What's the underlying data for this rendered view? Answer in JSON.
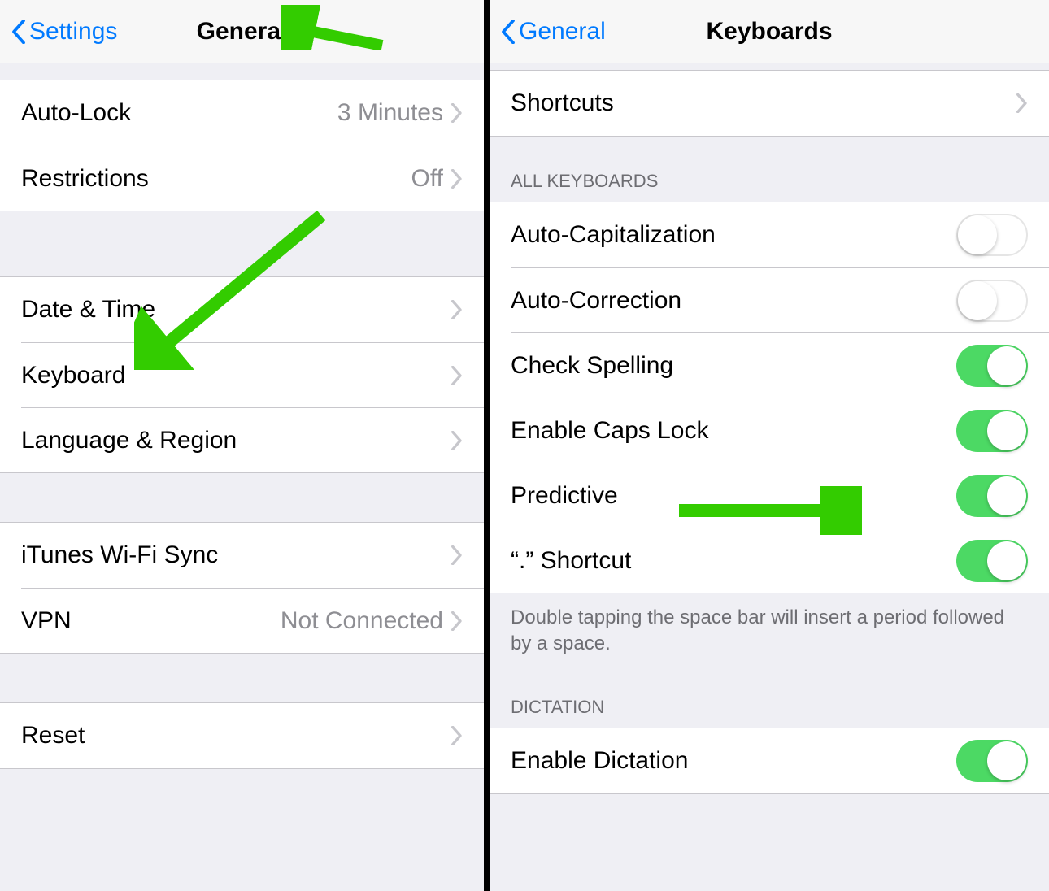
{
  "colors": {
    "accent": "#007aff",
    "toggleOn": "#4cd964",
    "arrow": "#33cc00"
  },
  "left": {
    "back": "Settings",
    "title": "General",
    "groups": [
      {
        "rows": [
          {
            "label": "Auto-Lock",
            "value": "3 Minutes",
            "disclosure": true
          },
          {
            "label": "Restrictions",
            "value": "Off",
            "disclosure": true
          }
        ]
      },
      {
        "rows": [
          {
            "label": "Date & Time",
            "disclosure": true
          },
          {
            "label": "Keyboard",
            "disclosure": true
          },
          {
            "label": "Language & Region",
            "disclosure": true
          }
        ]
      },
      {
        "rows": [
          {
            "label": "iTunes Wi-Fi Sync",
            "disclosure": true
          },
          {
            "label": "VPN",
            "value": "Not Connected",
            "disclosure": true
          }
        ]
      },
      {
        "rows": [
          {
            "label": "Reset",
            "disclosure": true
          }
        ]
      }
    ]
  },
  "right": {
    "back": "General",
    "title": "Keyboards",
    "shortcuts": {
      "label": "Shortcuts"
    },
    "allHeader": "ALL KEYBOARDS",
    "toggles": [
      {
        "label": "Auto-Capitalization",
        "on": false
      },
      {
        "label": "Auto-Correction",
        "on": false
      },
      {
        "label": "Check Spelling",
        "on": true
      },
      {
        "label": "Enable Caps Lock",
        "on": true
      },
      {
        "label": "Predictive",
        "on": true
      },
      {
        "label": "“.” Shortcut",
        "on": true
      }
    ],
    "footer": "Double tapping the space bar will insert a period followed by a space.",
    "dictationHeader": "DICTATION",
    "dictationRow": {
      "label": "Enable Dictation",
      "on": true
    }
  }
}
